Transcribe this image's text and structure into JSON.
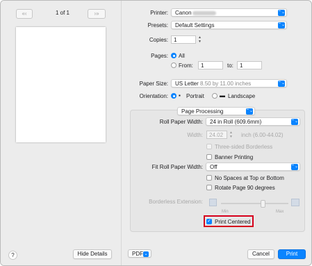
{
  "preview": {
    "page_indicator": "1 of 1",
    "first_prev_icon": "«‹",
    "next_last_icon": "›»"
  },
  "printer": {
    "label": "Printer:",
    "value": "Canon"
  },
  "presets": {
    "label": "Presets:",
    "value": "Default Settings"
  },
  "copies": {
    "label": "Copies:",
    "value": "1"
  },
  "pages": {
    "label": "Pages:",
    "all_label": "All",
    "from_label": "From:",
    "from_value": "1",
    "to_label": "to:",
    "to_value": "1"
  },
  "paper_size": {
    "label": "Paper Size:",
    "value": "US Letter",
    "detail": "8.50 by 11.00 inches"
  },
  "orientation": {
    "label": "Orientation:",
    "portrait": "Portrait",
    "landscape": "Landscape"
  },
  "section": {
    "value": "Page Processing"
  },
  "roll_width": {
    "label": "Roll Paper Width:",
    "value": "24 in Roll (609.6mm)"
  },
  "width": {
    "label": "Width:",
    "value": "24.02",
    "unit": "inch (6.00-44.02)"
  },
  "options": {
    "three_sided": "Three-sided Borderless",
    "banner": "Banner Printing",
    "fit_label": "Fit Roll Paper Width:",
    "fit_value": "Off",
    "no_spaces": "No Spaces at Top or Bottom",
    "rotate": "Rotate Page 90 degrees",
    "borderless_ext": "Borderless Extension:",
    "min": "Min",
    "max": "Max",
    "print_centered": "Print Centered"
  },
  "footer": {
    "help": "?",
    "hide_details": "Hide Details",
    "pdf": "PDF",
    "cancel": "Cancel",
    "print": "Print"
  },
  "colors": {
    "accent": "#0a84ff",
    "highlight": "#d6001c"
  }
}
